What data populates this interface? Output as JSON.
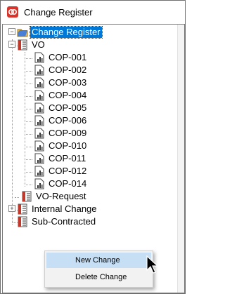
{
  "window": {
    "title": "Change Register"
  },
  "tree": {
    "root": "Change Register",
    "vo": {
      "label": "VO",
      "children": [
        "COP-001",
        "COP-002",
        "COP-003",
        "COP-004",
        "COP-005",
        "COP-006",
        "COP-009",
        "COP-010",
        "COP-011",
        "COP-012",
        "COP-014"
      ]
    },
    "vo_request": "VO-Request",
    "internal_change": "Internal Change",
    "sub_contracted": "Sub-Contracted"
  },
  "context_menu": {
    "new_change": "New Change",
    "delete_change": "Delete Change"
  },
  "colors": {
    "selection": "#0078d7",
    "menu_hover": "#c7dff5",
    "app_icon": "#d9342b"
  }
}
